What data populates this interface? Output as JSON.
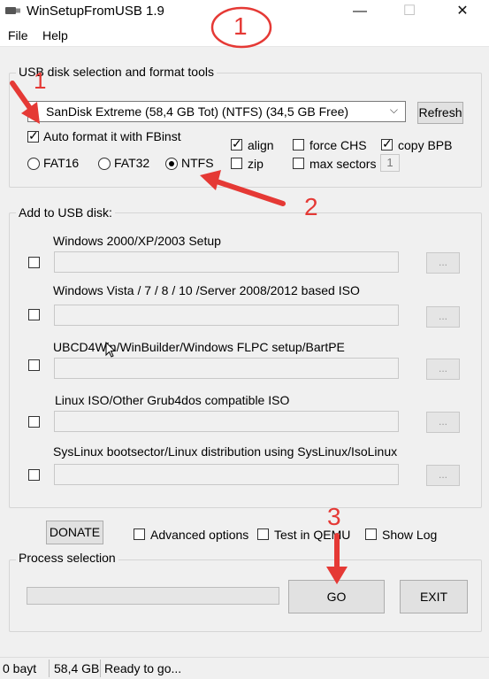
{
  "window": {
    "title": "WinSetupFromUSB 1.9",
    "controls": [
      "—",
      "☐",
      "✕"
    ]
  },
  "menu": {
    "file": "File",
    "help": "Help"
  },
  "usb_section": {
    "legend": "USB disk selection and format tools",
    "selected_disk": "SanDisk Extreme (58,4 GB Tot) (NTFS) (34,5 GB Free)",
    "refresh_label": "Refresh",
    "auto_format_label": "Auto format it with FBinst",
    "auto_format_checked": true,
    "fs_options": [
      "FAT16",
      "FAT32",
      "NTFS"
    ],
    "fs_selected": "NTFS",
    "align_label": "align",
    "align_checked": true,
    "zip_label": "zip",
    "zip_checked": false,
    "force_chs_label": "force CHS",
    "force_chs_checked": false,
    "max_sectors_label": "max sectors",
    "max_sectors_checked": false,
    "max_sectors_value": "1",
    "copy_bpb_label": "copy BPB",
    "copy_bpb_checked": true
  },
  "add_section": {
    "legend": "Add to USB disk:",
    "browse_label": "...",
    "items": [
      {
        "label": "Windows 2000/XP/2003 Setup"
      },
      {
        "label": "Windows Vista / 7 / 8 / 10 /Server 2008/2012 based ISO"
      },
      {
        "label": "UBCD4Win/WinBuilder/Windows FLPC setup/BartPE"
      },
      {
        "label": "Linux ISO/Other Grub4dos compatible ISO"
      },
      {
        "label": "SysLinux bootsector/Linux distribution using SysLinux/IsoLinux"
      }
    ]
  },
  "bottom": {
    "donate_label": "DONATE",
    "advanced_options_label": "Advanced options",
    "test_qemu_label": "Test in QEMU",
    "show_log_label": "Show Log",
    "process_legend": "Process selection",
    "go_label": "GO",
    "exit_label": "EXIT",
    "progress": 0
  },
  "status": {
    "bytes": "0 bayt",
    "size": "58,4 GB",
    "message": "Ready to go..."
  },
  "annotations": {
    "step1_top": "1",
    "step1_left": "1",
    "step2": "2",
    "step3": "3",
    "color": "#e53935"
  }
}
